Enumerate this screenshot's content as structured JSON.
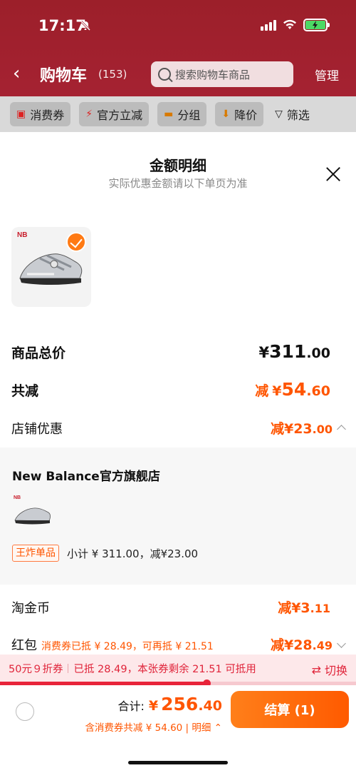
{
  "status_bar": {
    "time": "17:17"
  },
  "background": {
    "title": "购物车",
    "count": "(153)",
    "search_placeholder": "搜索购物车商品",
    "manage": "管理",
    "filters": [
      {
        "icon": "coupon-icon",
        "label": "消费券"
      },
      {
        "icon": "lightning-icon",
        "label": "官方立减"
      },
      {
        "icon": "folder-icon",
        "label": "分组"
      },
      {
        "icon": "price-drop-icon",
        "label": "降价"
      },
      {
        "icon": "filter-icon",
        "label": "筛选"
      }
    ]
  },
  "sheet": {
    "title": "金额明细",
    "subtitle": "实际优惠金额请以下单页为准",
    "rows": {
      "total_label": "商品总价",
      "total_yen": "¥",
      "total_int": "311",
      "total_dec": ".00",
      "saved_label": "共减",
      "saved_prefix": "减",
      "saved_yen": "¥",
      "saved_int": "54",
      "saved_dec": ".60",
      "store_discount_label": "店铺优惠",
      "store_discount_main": "减¥23",
      "store_discount_dec": ".00",
      "taojinbi_label": "淘金币",
      "taojinbi_main": "减¥3",
      "taojinbi_dec": ".11",
      "hongbao_label": "红包",
      "hongbao_note": "消费券已抵 ¥ 28.49，可再抵 ¥ 21.51",
      "hongbao_main": "减¥28",
      "hongbao_dec": ".49"
    },
    "store": {
      "name": "New Balance官方旗舰店",
      "tag": "王炸单品",
      "subtotal": "小计 ¥ 311.00，减¥23.00"
    }
  },
  "coupon_bar": {
    "part1": "50元９折券",
    "part2": "已抵 28.49，本张券剩余 21.51 可抵用",
    "switch_label": "切换",
    "progress": 0.58
  },
  "bottom": {
    "total_label": "合计:",
    "total_yen": "¥",
    "total_int": "256",
    "total_dec": ".40",
    "sub": "含消费券共减 ¥ 54.60 | 明细",
    "checkout": "结算 (1)"
  },
  "colors": {
    "accent": "#ff5500",
    "header": "#a52232",
    "coupon": "#e8243a"
  }
}
